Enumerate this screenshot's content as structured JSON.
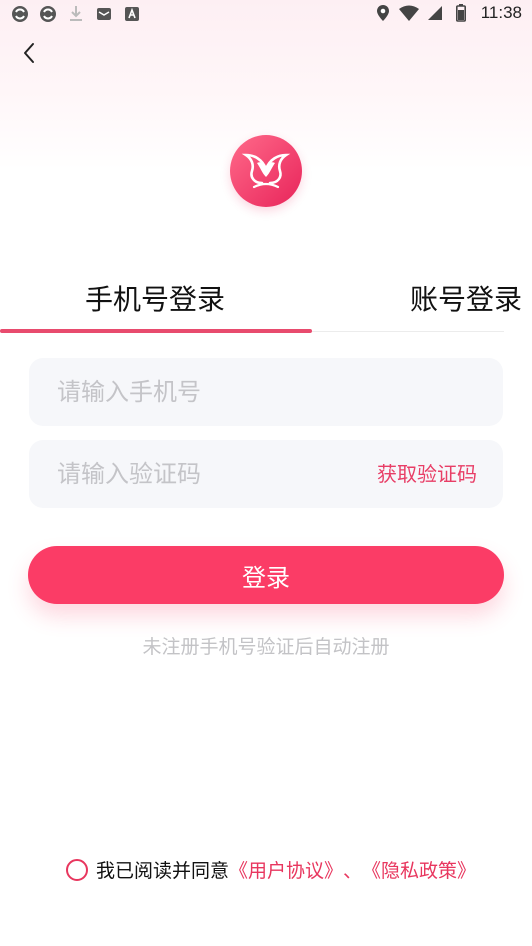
{
  "status_bar": {
    "time": "11:38",
    "left_icons": [
      "sync-icon",
      "sync-icon",
      "download-icon",
      "mail-icon",
      "font-app-icon"
    ],
    "right_icons": [
      "location-icon",
      "wifi-icon",
      "signal-icon",
      "battery-icon"
    ]
  },
  "header": {
    "back_icon": "chevron-left-icon",
    "logo_icon": "swan-logo-icon"
  },
  "tabs": [
    {
      "label": "手机号登录",
      "active": true
    },
    {
      "label": "账号登录",
      "active": false
    }
  ],
  "form": {
    "phone_placeholder": "请输入手机号",
    "code_placeholder": "请输入验证码",
    "get_code_label": "获取验证码",
    "login_label": "登录",
    "hint": "未注册手机号验证后自动注册"
  },
  "agreement": {
    "text": "我已阅读并同意",
    "user_agreement": "《用户协议》",
    "separator": "、",
    "privacy_policy": "《隐私政策》",
    "checked": false
  },
  "colors": {
    "accent": "#fb3c66",
    "link": "#e8365e",
    "tab_indicator": "#e84b6e",
    "field_bg": "#f6f7fa",
    "placeholder": "#c4c4c8"
  }
}
